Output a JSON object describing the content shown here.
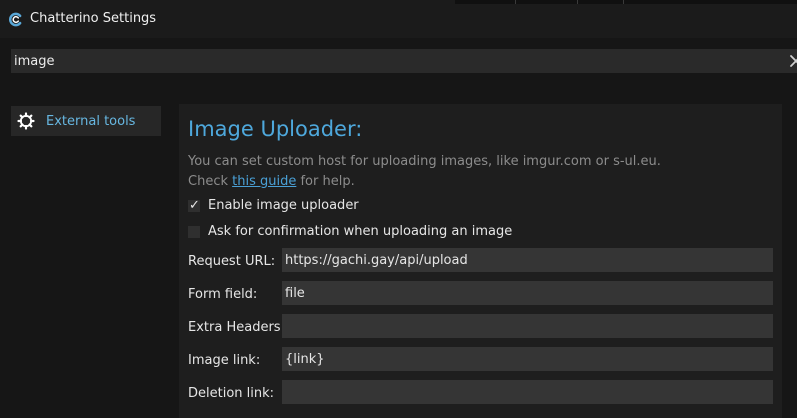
{
  "window": {
    "title": "Chatterino Settings"
  },
  "search": {
    "value": "image"
  },
  "sidebar": {
    "items": [
      {
        "label": "External tools",
        "icon": "gear-icon",
        "selected": true
      }
    ]
  },
  "section": {
    "title": "Image Uploader:",
    "description_line1": "You can set custom host for uploading images, like imgur.com or s-ul.eu.",
    "description_prefix": "Check ",
    "description_link": "this guide",
    "description_suffix": " for help."
  },
  "checkboxes": [
    {
      "label": "Enable image uploader",
      "checked": true
    },
    {
      "label": "Ask for confirmation when uploading an image",
      "checked": false
    }
  ],
  "fields": [
    {
      "label": "Request URL:",
      "value": "https://gachi.gay/api/upload"
    },
    {
      "label": "Form field:",
      "value": "file"
    },
    {
      "label": "Extra Headers:",
      "value": ""
    },
    {
      "label": "Image link:",
      "value": "{link}"
    },
    {
      "label": "Deletion link:",
      "value": ""
    }
  ],
  "colors": {
    "background": "#161616",
    "panel": "#1e1e1e",
    "accent": "#4ea8dc",
    "input": "#353535"
  }
}
